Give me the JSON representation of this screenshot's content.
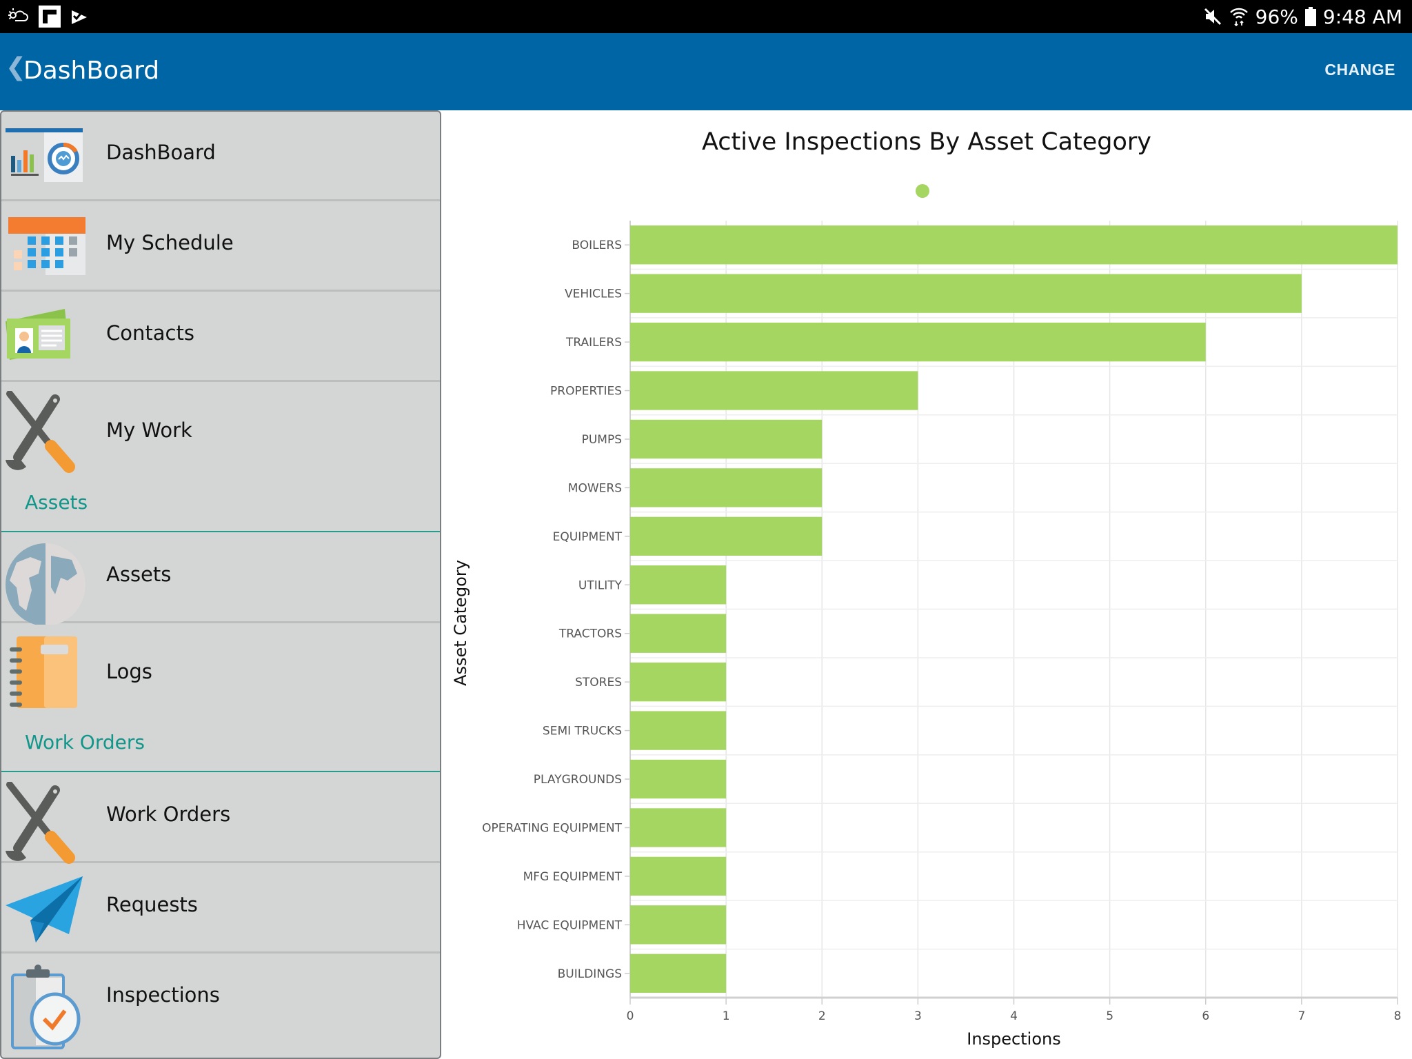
{
  "status_bar": {
    "left_icons": [
      "weather-icon",
      "flipboard-icon",
      "task-check-icon"
    ],
    "mute_icon": "mute-icon",
    "wifi_icon": "wifi-icon",
    "battery_percent": "96%",
    "battery_icon": "battery-icon",
    "time": "9:48 AM"
  },
  "app_bar": {
    "back_glyph": "❮",
    "title": "DashBoard",
    "action_label": "CHANGE",
    "color": "#0065a4"
  },
  "sidebar": {
    "items_top": [
      {
        "label": "DashBoard",
        "icon": "dashboard-icon"
      },
      {
        "label": "My Schedule",
        "icon": "calendar-icon"
      },
      {
        "label": "Contacts",
        "icon": "contact-card-icon"
      },
      {
        "label": "My Work",
        "icon": "tools-icon"
      }
    ],
    "section_assets": "Assets",
    "items_assets": [
      {
        "label": "Assets",
        "icon": "globe-icon"
      },
      {
        "label": "Logs",
        "icon": "notebook-icon"
      }
    ],
    "section_work_orders": "Work Orders",
    "items_work_orders": [
      {
        "label": "Work Orders",
        "icon": "tools-icon"
      },
      {
        "label": "Requests",
        "icon": "paper-plane-icon"
      },
      {
        "label": "Inspections",
        "icon": "clipboard-check-icon"
      }
    ],
    "section_color": "#11968a"
  },
  "chart_data": {
    "type": "bar",
    "orientation": "horizontal",
    "title": "Active Inspections By Asset Category",
    "xlabel": "Inspections",
    "ylabel": "Asset Category",
    "xlim": [
      0,
      8
    ],
    "xticks": [
      "0",
      "1",
      "2",
      "3",
      "4",
      "5",
      "6",
      "7",
      "8"
    ],
    "grid": true,
    "legend": {
      "placement": "top-center",
      "entries": [
        {
          "name": "",
          "color": "#a5d662"
        }
      ]
    },
    "bar_color": "#a5d662",
    "categories": [
      "BOILERS",
      "VEHICLES",
      "TRAILERS",
      "PROPERTIES",
      "PUMPS",
      "MOWERS",
      "EQUIPMENT",
      "UTILITY",
      "TRACTORS",
      "STORES",
      "SEMI TRUCKS",
      "PLAYGROUNDS",
      "OPERATING EQUIPMENT",
      "MFG EQUIPMENT",
      "HVAC EQUIPMENT",
      "BUILDINGS"
    ],
    "values": [
      8,
      7,
      6,
      3,
      2,
      2,
      2,
      1,
      1,
      1,
      1,
      1,
      1,
      1,
      1,
      1
    ]
  }
}
